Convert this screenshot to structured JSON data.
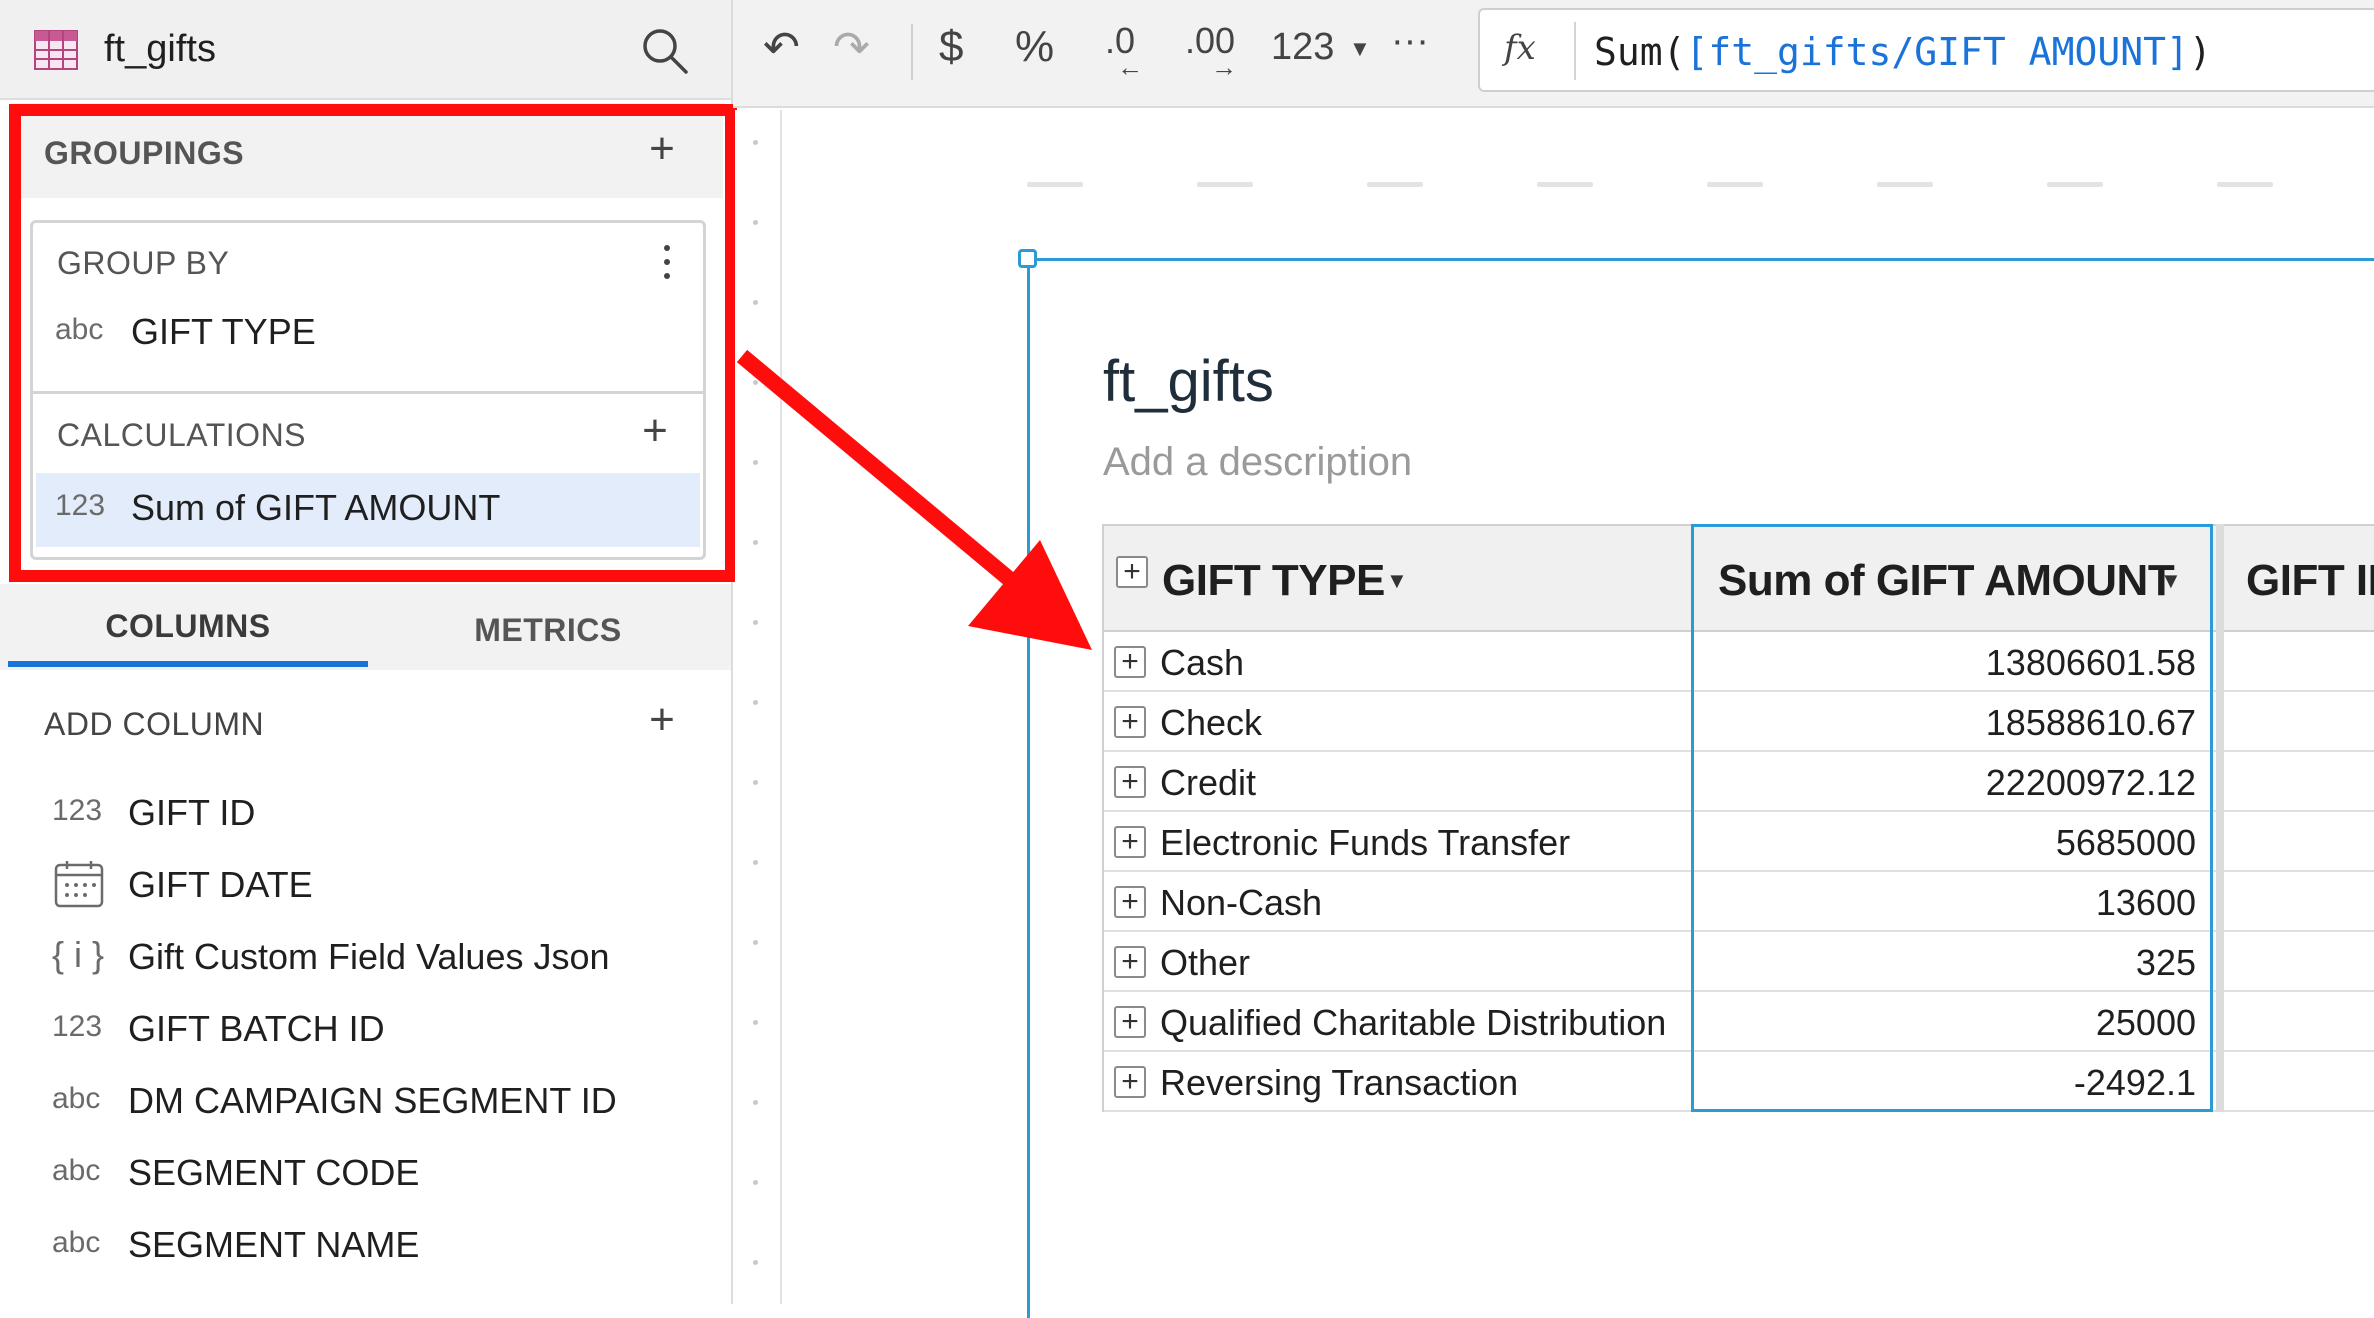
{
  "panel": {
    "title": "ft_gifts",
    "groupings_label": "GROUPINGS",
    "group_by_label": "GROUP BY",
    "group_by_field": {
      "type": "abc",
      "name": "GIFT TYPE"
    },
    "calculations_label": "CALCULATIONS",
    "calculation_field": {
      "type": "123",
      "name": "Sum of GIFT AMOUNT"
    },
    "tabs": [
      {
        "label": "COLUMNS"
      },
      {
        "label": "METRICS"
      }
    ],
    "add_column_label": "ADD COLUMN",
    "columns": [
      {
        "type": "123",
        "name": "GIFT ID",
        "icon": "number"
      },
      {
        "type": "",
        "name": "GIFT DATE",
        "icon": "calendar-icon"
      },
      {
        "type": "{ i }",
        "name": "Gift Custom Field Values Json",
        "icon": "json"
      },
      {
        "type": "123",
        "name": "GIFT BATCH ID",
        "icon": "number"
      },
      {
        "type": "abc",
        "name": "DM CAMPAIGN SEGMENT ID",
        "icon": "text"
      },
      {
        "type": "abc",
        "name": "SEGMENT CODE",
        "icon": "text"
      },
      {
        "type": "abc",
        "name": "SEGMENT NAME",
        "icon": "text"
      }
    ]
  },
  "toolbar": {
    "undo": "↶",
    "redo": "↷",
    "currency": "$",
    "percent": "%",
    "decimal_decrease": ".0",
    "decimal_increase": ".00",
    "number_format": "123",
    "more": "···",
    "fx": "fx",
    "formula_prefix": "Sum(",
    "formula_ref": "[ft_gifts/GIFT AMOUNT]",
    "formula_suffix": ")"
  },
  "element": {
    "title": "ft_gifts",
    "description_placeholder": "Add a description",
    "columns": [
      "GIFT TYPE",
      "Sum of GIFT AMOUNT",
      "GIFT ID"
    ],
    "rows": [
      {
        "type": "Cash",
        "sum": "13806601.58"
      },
      {
        "type": "Check",
        "sum": "18588610.67"
      },
      {
        "type": "Credit",
        "sum": "22200972.12"
      },
      {
        "type": "Electronic Funds Transfer",
        "sum": "5685000"
      },
      {
        "type": "Non-Cash",
        "sum": "13600"
      },
      {
        "type": "Other",
        "sum": "325"
      },
      {
        "type": "Qualified Charitable Distribution",
        "sum": "25000"
      },
      {
        "type": "Reversing Transaction",
        "sum": "-2492.1"
      }
    ]
  },
  "colors": {
    "highlight": "#ff0d0d",
    "accent": "#1a73d9",
    "selection": "#2a9bd6"
  }
}
